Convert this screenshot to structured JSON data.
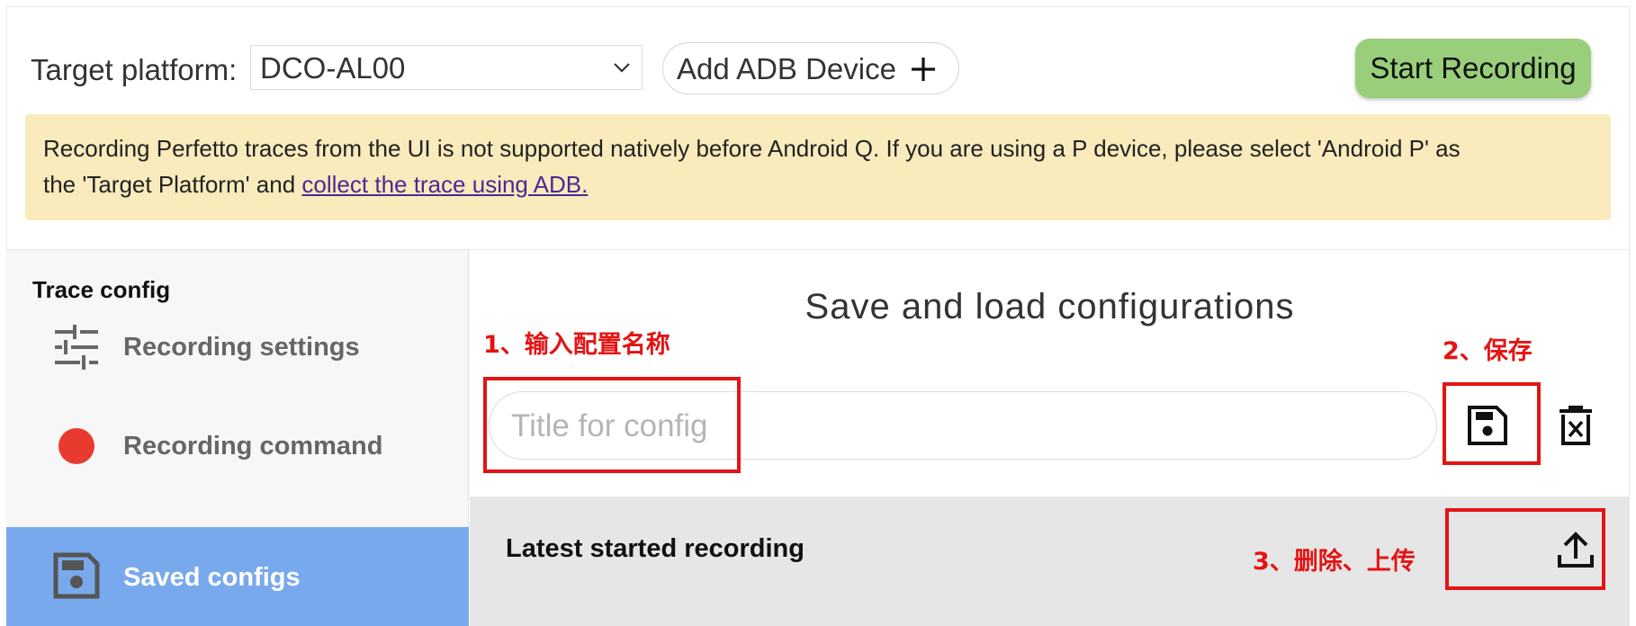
{
  "toolbar": {
    "platform_label": "Target platform:",
    "platform_value": "DCO-AL00",
    "add_adb_label": "Add ADB Device",
    "start_recording_label": "Start Recording"
  },
  "warning": {
    "line1": "Recording Perfetto traces from the UI is not supported natively before Android Q. If you are using a P device, please select 'Android P' as",
    "line2_prefix": "the 'Target Platform' and ",
    "link": "collect the trace using ADB."
  },
  "sidebar": {
    "heading": "Trace config",
    "items": [
      {
        "label": "Recording settings",
        "icon": "tune-icon"
      },
      {
        "label": "Recording command",
        "icon": "red-dot-icon"
      },
      {
        "label": "Saved configs",
        "icon": "save-icon"
      }
    ]
  },
  "main": {
    "title": "Save and load configurations",
    "input_placeholder": "Title for config",
    "latest_label": "Latest started recording"
  },
  "annotations": {
    "step1": "1、输入配置名称",
    "step2": "2、保存",
    "step3": "3、删除、上传"
  },
  "colors": {
    "start_button": "#99cf7a",
    "warning_bg": "#f9ebbc",
    "active_item": "#78a9ec",
    "annotation_red": "#e31414"
  }
}
